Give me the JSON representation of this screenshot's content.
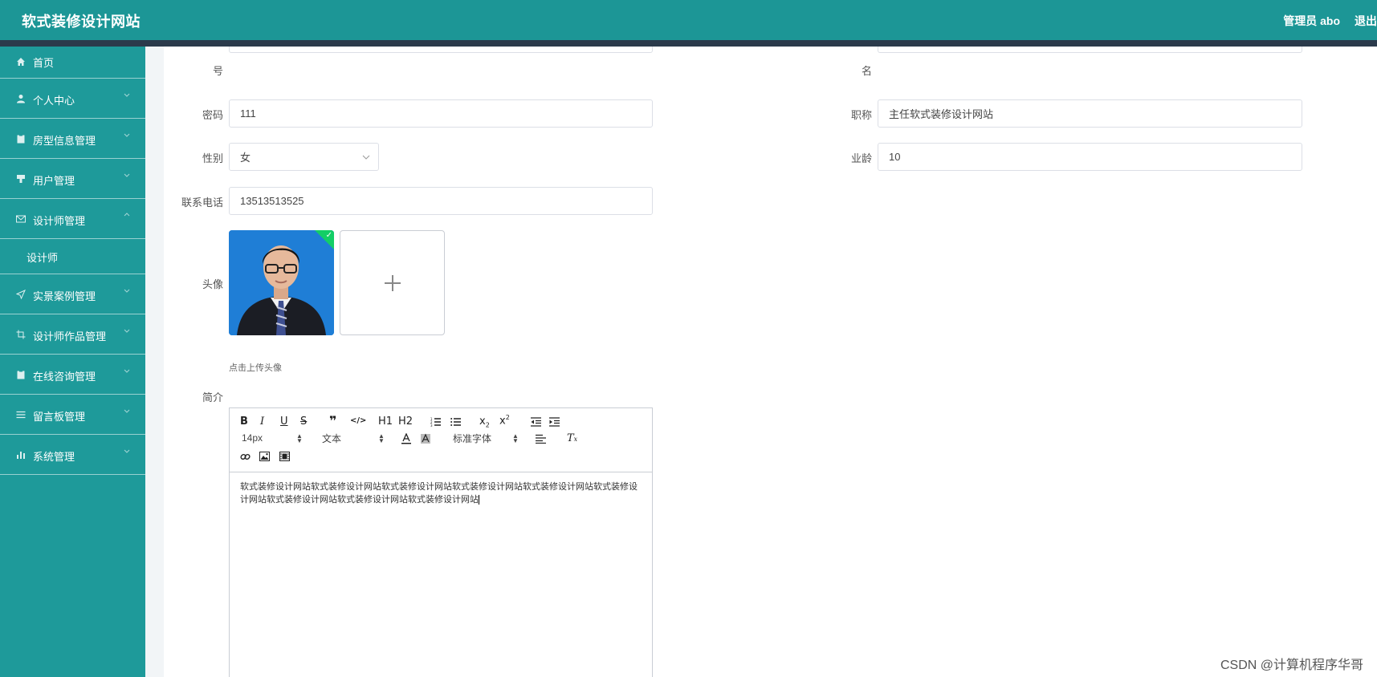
{
  "header": {
    "app_title": "软式装修设计网站",
    "user_label": "管理员 abo",
    "logout_label": "退出"
  },
  "colors": {
    "header_bg": "#1c9696",
    "sidebar_bg": "#1e9a9a",
    "accent_strip": "#2b3a4b",
    "success_badge": "#13ce66"
  },
  "sidebar": {
    "items": [
      {
        "label": "首页",
        "icon": "home-icon",
        "expanded": null
      },
      {
        "label": "个人中心",
        "icon": "user-icon",
        "expanded": false
      },
      {
        "label": "房型信息管理",
        "icon": "clipboard-icon",
        "expanded": false
      },
      {
        "label": "用户管理",
        "icon": "stamp-icon",
        "expanded": false
      },
      {
        "label": "设计师管理",
        "icon": "mail-icon",
        "expanded": true
      },
      {
        "label": "设计师",
        "icon": null,
        "submenu": true
      },
      {
        "label": "实景案例管理",
        "icon": "send-icon",
        "expanded": false
      },
      {
        "label": "设计师作品管理",
        "icon": "crop-icon",
        "expanded": false
      },
      {
        "label": "在线咨询管理",
        "icon": "clipboard-icon",
        "expanded": false
      },
      {
        "label": "留言板管理",
        "icon": "list-icon",
        "expanded": false
      },
      {
        "label": "系统管理",
        "icon": "bar-chart-icon",
        "expanded": false
      }
    ]
  },
  "form": {
    "top_left_label_tail": "号",
    "top_right_label_tail": "名",
    "password": {
      "label": "密码",
      "value": "111"
    },
    "title": {
      "label": "职称",
      "value": "主任软式装修设计网站"
    },
    "gender": {
      "label": "性别",
      "value": "女"
    },
    "years": {
      "label": "业龄",
      "value": "10"
    },
    "phone": {
      "label": "联系电话",
      "value": "13513513525"
    },
    "avatar": {
      "label": "头像",
      "hint": "点击上传头像",
      "uploaded": true
    },
    "intro": {
      "label": "简介",
      "toolbar": {
        "font_size": "14px",
        "header_select": "文本",
        "font_family": "标准字体",
        "h1": "H1",
        "h2": "H2"
      },
      "content": "软式装修设计网站软式装修设计网站软式装修设计网站软式装修设计网站软式装修设计网站软式装修设计网站软式装修设计网站软式装修设计网站软式装修设计网站"
    }
  },
  "watermark": "CSDN @计算机程序华哥"
}
